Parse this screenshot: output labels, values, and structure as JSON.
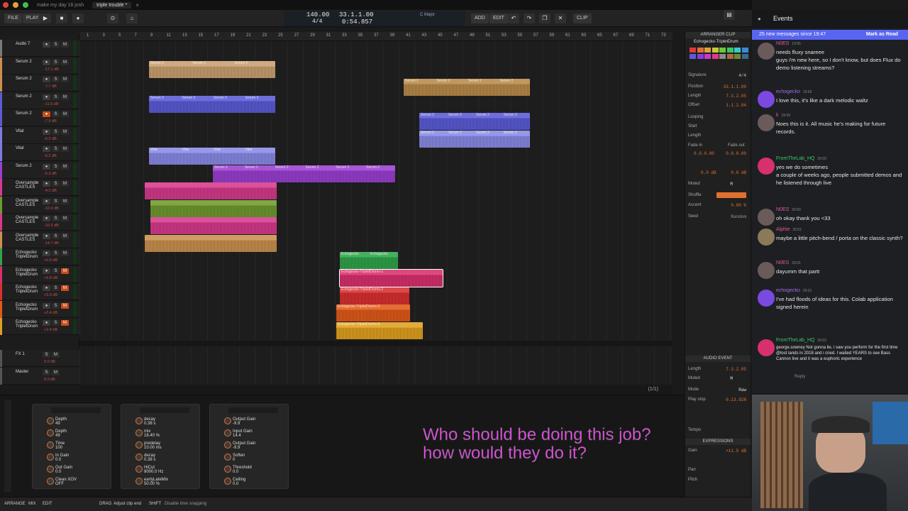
{
  "window": {
    "tabs": [
      "make my day 16 josh",
      "triple trouble *"
    ],
    "close_glyph": "×"
  },
  "toolbar": {
    "file_label": "FILE",
    "play_label": "PLAY",
    "add_label": "ADD",
    "edit_label": "EDIT",
    "clip_label": "CLIP",
    "tempo": "140.00",
    "signature": "4/4",
    "position": "33.1.1.00",
    "time": "0:54.857",
    "key": "C Major"
  },
  "ruler": {
    "bars": [
      "1",
      "3",
      "5",
      "7",
      "9",
      "11",
      "13",
      "15",
      "17",
      "19",
      "21",
      "23",
      "25",
      "27",
      "29",
      "31",
      "33",
      "35",
      "37",
      "39",
      "41",
      "43",
      "45",
      "47",
      "49",
      "51",
      "53",
      "55",
      "57",
      "59",
      "61",
      "63",
      "65",
      "67",
      "69",
      "71",
      "73"
    ]
  },
  "tracks": [
    {
      "name": "Audio 7",
      "db": "",
      "color": "#7a7a7a",
      "armed": false,
      "monitor": false
    },
    {
      "name": "Serum 2",
      "db": "-17.1 dB",
      "color": "#c9904f",
      "armed": false,
      "monitor": false
    },
    {
      "name": "Serum 2",
      "db": "-7.7 dB",
      "color": "#c9904f",
      "armed": false,
      "monitor": false
    },
    {
      "name": "Serum 2",
      "db": "-11.5 dB",
      "color": "#5b5bd6",
      "armed": false,
      "monitor": false
    },
    {
      "name": "Serum 2",
      "db": "-7.9 dB",
      "color": "#5b5bd6",
      "armed": true,
      "monitor": false
    },
    {
      "name": "Vital",
      "db": "-6.2 dB",
      "color": "#7c7ce0",
      "armed": false,
      "monitor": false
    },
    {
      "name": "Vital",
      "db": "-6.2 dB",
      "color": "#7c7ce0",
      "armed": false,
      "monitor": false
    },
    {
      "name": "Serum 2",
      "db": "-5.3 dB",
      "color": "#9a3fd0",
      "armed": false,
      "monitor": false
    },
    {
      "name": "Oversample\nCASTLES",
      "db": "-4.2 dB",
      "color": "#d63a8c",
      "armed": false,
      "monitor": false
    },
    {
      "name": "Oversample\nCASTLES",
      "db": "-10.0 dB",
      "color": "#6f9a2f",
      "armed": false,
      "monitor": false
    },
    {
      "name": "Oversample\nCASTLES",
      "db": "-10.5 dB",
      "color": "#d63a8c",
      "armed": false,
      "monitor": false
    },
    {
      "name": "Oversample\nCASTLES",
      "db": "-14.7 dB",
      "color": "#c9904f",
      "armed": false,
      "monitor": false
    },
    {
      "name": "Echogecko\nTripletDrum",
      "db": "+0.6 dB",
      "color": "#2fa44a",
      "armed": false,
      "monitor": false
    },
    {
      "name": "Echogecko\nTripletDrum",
      "db": "+5.8 dB",
      "color": "#d8306e",
      "armed": false,
      "monitor": true
    },
    {
      "name": "Echogecko\nTripletDrum",
      "db": "+5.0 dB",
      "color": "#d83030",
      "armed": false,
      "monitor": true
    },
    {
      "name": "Echogecko\nTripletDrum",
      "db": "+3.4 dB",
      "color": "#e05a1a",
      "armed": false,
      "monitor": true
    },
    {
      "name": "Echogecko\nTripletDrum",
      "db": "+2.4 dB",
      "color": "#e0a020",
      "armed": false,
      "monitor": true
    }
  ],
  "fx_tracks": [
    {
      "name": "FX 1",
      "db": "0.0 dB",
      "color": "#555"
    },
    {
      "name": "Master",
      "db": "0.0 dB",
      "color": "#555"
    }
  ],
  "clip_labels": {
    "serum": "Serum 2",
    "vital": "Vital",
    "echo": "Echogecko",
    "triplet1": "Echogecko-TripletDrums-1",
    "triplet2": "Echogecko-TripletDrums-2",
    "triplet3": "Echogecko-TripletDrums-3",
    "triplet4": "Echogecko-TripletDrums-4"
  },
  "inspector": {
    "title": "ARRANGER CLIP",
    "clip_name": "Echogecko-TripletDrum",
    "signature_label": "Signature",
    "signature_val": "4/4",
    "position_label": "Position",
    "position_val": "33.1.1.00",
    "length_label": "Length",
    "length_val": "7.3.2.05",
    "offset_label": "Offset",
    "offset_val": "1.1.2.94",
    "looping_label": "Looping",
    "start_label": "Start",
    "loop_length_label": "Length",
    "fadein_label": "Fade in",
    "fadeout_label": "Fade out",
    "fadein_val": "0.0.0.00",
    "fadeout_val": "0.0.0.00",
    "gain_left": "0.0 dB",
    "gain_right": "0.0 dB",
    "muted_label": "Muted",
    "muted_val": "M",
    "shuffle_label": "Shuffle",
    "accent_label": "Accent",
    "accent_val": "0.00 %",
    "seed_label": "Seed",
    "seed_val": "Random",
    "audio_event_title": "AUDIO EVENT",
    "ae_length_label": "Length",
    "ae_length_val": "7.3.2.05",
    "ae_muted_label": "Muted",
    "ae_muted_val": "M",
    "mode_label": "Mode",
    "mode_val": "Raw",
    "playstop_label": "Play stop",
    "playstop_val": "0.13.928",
    "tempo_label": "Tempo",
    "expressions_title": "EXPRESSIONS",
    "gain_label": "Gain",
    "gain_val": "+11.5 dB",
    "pan_label": "Pan",
    "pitch_label": "Pitch",
    "swatch_colors": [
      "#e03a3a",
      "#e0703a",
      "#e0a03a",
      "#c8c83a",
      "#6ac83a",
      "#3ac86a",
      "#3ac8c8",
      "#3a8ae0",
      "#5a5ae0",
      "#8a3ae0",
      "#c83ac8",
      "#e03a8a",
      "#8a8a8a",
      "#b06a3a",
      "#6a8a3a",
      "#3a6a8a"
    ]
  },
  "devices": [
    {
      "params": [
        "Depth\n49",
        "Depth\n49",
        "Time\n100",
        "In Gain\n0.0",
        "Out Gain\n0.0",
        "Clean XOV\nOFF"
      ]
    },
    {
      "params": [
        "decay\n0.38 s",
        "mix\n18.40 %",
        "predelay\n10.00 ms",
        "decay\n0.38 s",
        "HiCut\n8000.0 Hz",
        "earlyLateMix\n50.00 %"
      ]
    },
    {
      "params": [
        "Output Gain\n-9.9",
        "Input Gain\n14.4",
        "Output Gain\n-9.9",
        "Soften\n0",
        "Threshold\n0.0",
        "Ceiling\n0.0"
      ]
    }
  ],
  "caption": {
    "line1": "Who should be doing this job?",
    "line2": "how would they do it?"
  },
  "status": {
    "arrange": "ARRANGE",
    "mix": "MIX",
    "edit": "EDIT",
    "drag_label": "DRAG",
    "drag_hint": "Adjust clip end",
    "shift_label": "SHIFT",
    "shift_hint": "Disable time snapping",
    "page_counter": "(1/1)"
  },
  "chat": {
    "title": "Events",
    "banner": "25 new messages since 19:47",
    "mark_read": "Mark as Read",
    "messages": [
      {
        "user": "N0ES",
        "time": "19:55",
        "color": "#e05a9a",
        "avatar": "#6a5a5a",
        "text": "needs fluxy snareee\nguys i'm new here, so I don't know, but does Flux do demo listening streams?"
      },
      {
        "user": "echogecko",
        "time": "19:56",
        "color": "#a070e0",
        "avatar": "#7a4ae0",
        "text": "I love this, it's like a dark melodic waltz"
      },
      {
        "user": "k",
        "time": "19:59",
        "color": "#e05a9a",
        "avatar": "#6a5a5a",
        "text": "Noes this is it. All music he's making for future records."
      },
      {
        "user": "FromTheLab_HQ",
        "time": "20:00",
        "color": "#3ac86a",
        "avatar": "#d8306e",
        "text": "yes we do sometimes\na couple of weeks ago, people submitted demos and he listened through live"
      },
      {
        "user": "N0ES",
        "time": "20:00",
        "color": "#e05a9a",
        "avatar": "#6a5a5a",
        "text": "oh okay thank you <33"
      },
      {
        "user": "Alphie",
        "time": "20:01",
        "color": "#e05a9a",
        "avatar": "#8a7a5a",
        "text": "maybe a little pitch-bend / porta on the classic synth?"
      },
      {
        "user": "N0ES",
        "time": "20:01",
        "color": "#e05a9a",
        "avatar": "#6a5a5a",
        "text": "dayumm that partt"
      },
      {
        "user": "echogecko",
        "time": "20:01",
        "color": "#a070e0",
        "avatar": "#7a4ae0",
        "text": "I've had floods of ideas for this. Colab application signed herein"
      },
      {
        "user": "FromTheLab_HQ",
        "time": "20:02",
        "color": "#3ac86a",
        "avatar": "#d8306e",
        "text": "george.sowney Not gonna lie, i saw you perform for the first time @lost lands in 2018 and i cried. I waited YEARS to see Bass Cannon live and it was a euphoric experience"
      }
    ],
    "reply_label": "Reply"
  }
}
